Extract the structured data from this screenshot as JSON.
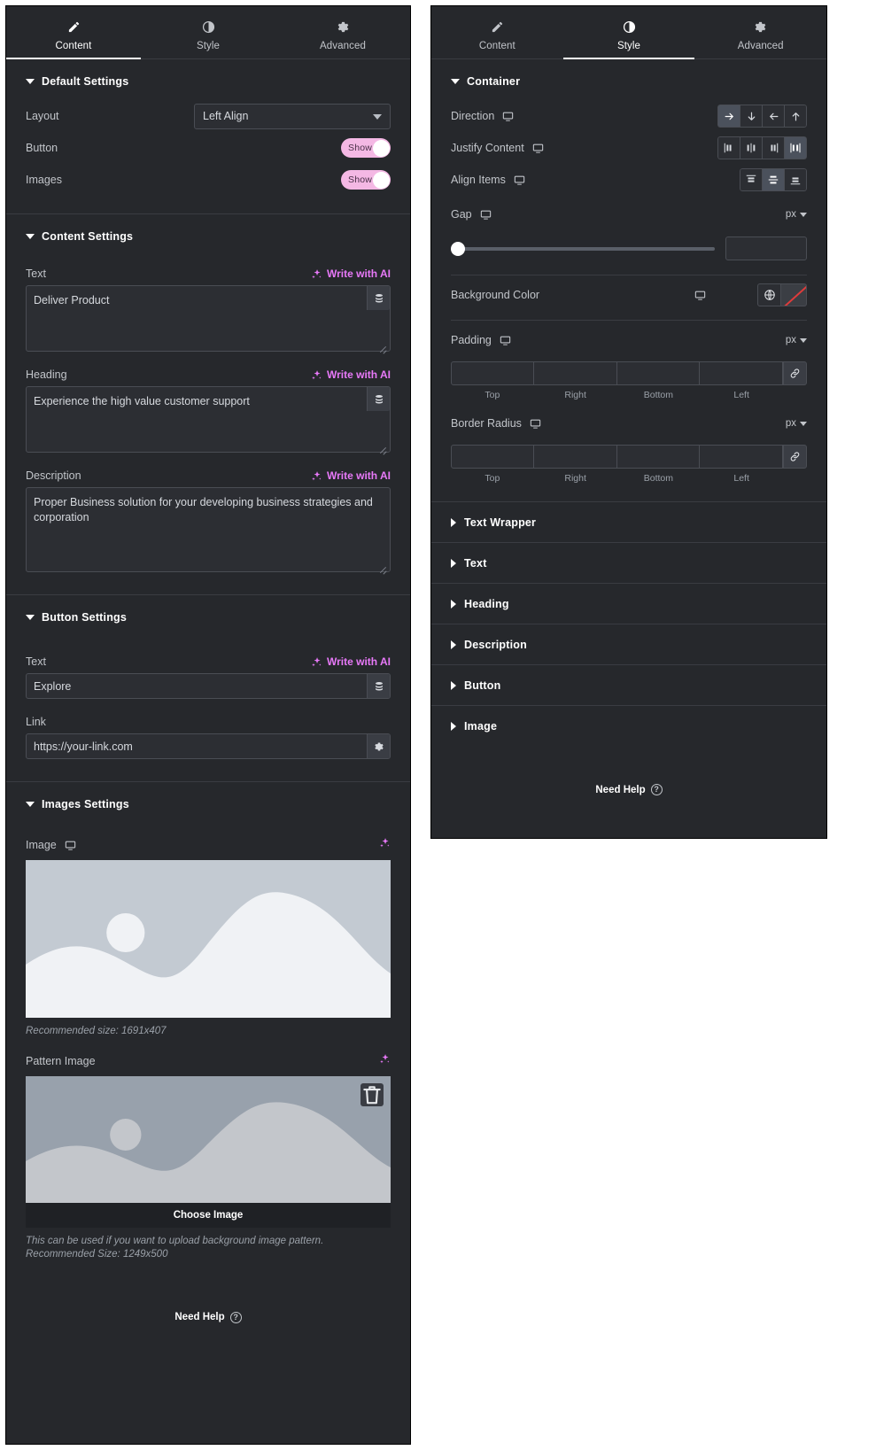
{
  "content_panel": {
    "tabs": [
      {
        "label": "Content",
        "icon": "pencil-icon",
        "active": true
      },
      {
        "label": "Style",
        "icon": "contrast-icon",
        "active": false
      },
      {
        "label": "Advanced",
        "icon": "gear-icon",
        "active": false
      }
    ],
    "default_settings": {
      "title": "Default Settings",
      "layout_label": "Layout",
      "layout_value": "Left Align",
      "button_label": "Button",
      "button_toggle": "Show",
      "images_label": "Images",
      "images_toggle": "Show"
    },
    "content_settings": {
      "title": "Content Settings",
      "ai_label": "Write with AI",
      "text_label": "Text",
      "text_value": "Deliver Product",
      "heading_label": "Heading",
      "heading_value": "Experience the high value customer support",
      "description_label": "Description",
      "description_value": "Proper Business solution for your developing business strategies and corporation"
    },
    "button_settings": {
      "title": "Button Settings",
      "ai_label": "Write with AI",
      "text_label": "Text",
      "text_value": "Explore",
      "link_label": "Link",
      "link_value": "https://your-link.com"
    },
    "images_settings": {
      "title": "Images Settings",
      "image_label": "Image",
      "image_hint": "Recommended size: 1691x407",
      "pattern_label": "Pattern Image",
      "choose_image": "Choose Image",
      "pattern_hint": "This can be used if you want to upload background image pattern. Recommended Size: 1249x500"
    },
    "footer": {
      "need_help": "Need Help"
    }
  },
  "style_panel": {
    "tabs": [
      {
        "label": "Content",
        "icon": "pencil-icon",
        "active": false
      },
      {
        "label": "Style",
        "icon": "contrast-icon",
        "active": true
      },
      {
        "label": "Advanced",
        "icon": "gear-icon",
        "active": false
      }
    ],
    "container": {
      "title": "Container",
      "direction_label": "Direction",
      "direction_options": [
        "arrow-right",
        "arrow-down",
        "arrow-left",
        "arrow-up"
      ],
      "direction_active": 0,
      "justify_label": "Justify Content",
      "justify_options": [
        "justify-start",
        "justify-center",
        "justify-end",
        "justify-space-between"
      ],
      "justify_active": 3,
      "align_label": "Align Items",
      "align_options": [
        "align-start",
        "align-center",
        "align-end"
      ],
      "align_active": 1,
      "gap_label": "Gap",
      "gap_unit": "px",
      "gap_value": "",
      "background_color_label": "Background Color",
      "padding_label": "Padding",
      "padding_unit": "px",
      "padding_values": [
        "",
        "",
        "",
        ""
      ],
      "padding_subs": [
        "Top",
        "Right",
        "Bottom",
        "Left"
      ],
      "border_radius_label": "Border Radius",
      "border_radius_unit": "px",
      "border_radius_values": [
        "",
        "",
        "",
        ""
      ],
      "border_radius_subs": [
        "Top",
        "Right",
        "Bottom",
        "Left"
      ]
    },
    "accordions": [
      {
        "label": "Text Wrapper"
      },
      {
        "label": "Text"
      },
      {
        "label": "Heading"
      },
      {
        "label": "Description"
      },
      {
        "label": "Button"
      },
      {
        "label": "Image"
      }
    ],
    "footer": {
      "need_help": "Need Help"
    }
  },
  "colors": {
    "panel_bg": "#26282c",
    "accent_pink": "#e879f9",
    "toggle_pink": "#f4b8e4",
    "no_color_slash": "#e03b3b",
    "active_btn": "#4b515c"
  }
}
